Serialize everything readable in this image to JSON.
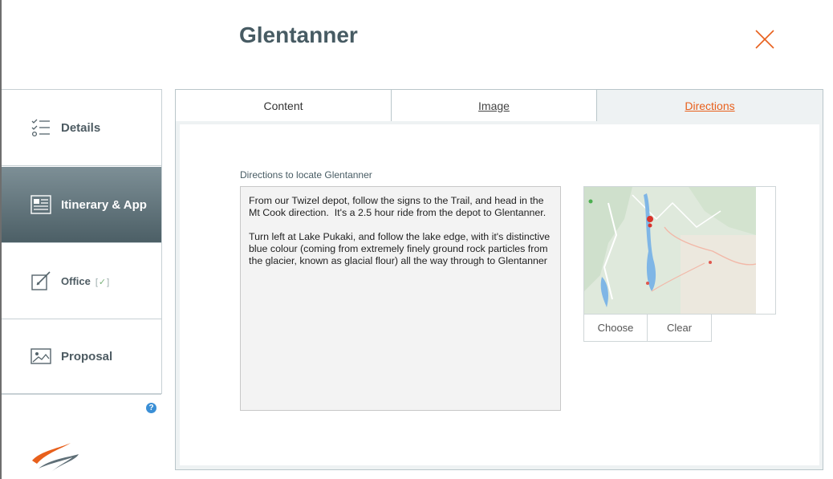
{
  "page": {
    "title": "Glentanner"
  },
  "sidebar": {
    "items": [
      {
        "label": "Details",
        "icon": "checklist-icon"
      },
      {
        "label": "Itinerary & App",
        "icon": "document-icon"
      },
      {
        "label": "Office",
        "icon": "edit-icon",
        "check_open": "[",
        "check_mark": "✓",
        "check_close": "]"
      },
      {
        "label": "Proposal",
        "icon": "image-icon"
      }
    ],
    "help_symbol": "?"
  },
  "tabs": [
    {
      "label": "Content"
    },
    {
      "label": "Image"
    },
    {
      "label": "Directions"
    }
  ],
  "directions": {
    "label": "Directions to locate Glentanner",
    "text": "From our Twizel depot, follow the signs to the Trail, and head in the Mt Cook direction.  It's a 2.5 hour ride from the depot to Glentanner.\n\nTurn left at Lake Pukaki, and follow the lake edge, with it's distinctive blue colour (coming from extremely finely ground rock particles from the glacier, known as glacial flour) all the way through to Glentanner"
  },
  "image_panel": {
    "choose_label": "Choose",
    "clear_label": "Clear"
  },
  "colors": {
    "accent": "#e8601c",
    "title": "#475b63",
    "active_tab_bg": "#eef2f3",
    "sidebar_active_top": "#7d8f96",
    "sidebar_active_bottom": "#4c5f66"
  }
}
